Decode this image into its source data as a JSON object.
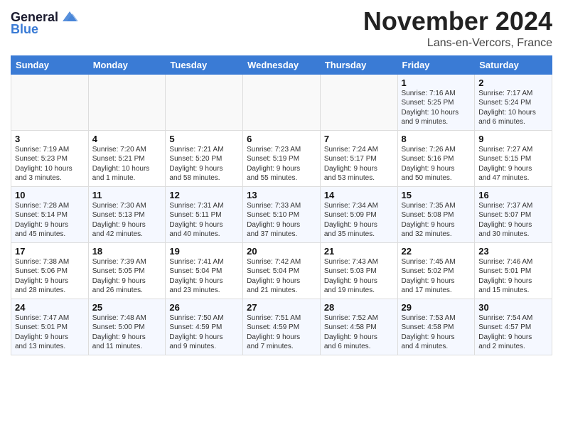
{
  "header": {
    "logo_line1": "General",
    "logo_line2": "Blue",
    "month_title": "November 2024",
    "location": "Lans-en-Vercors, France"
  },
  "weekdays": [
    "Sunday",
    "Monday",
    "Tuesday",
    "Wednesday",
    "Thursday",
    "Friday",
    "Saturday"
  ],
  "weeks": [
    [
      {
        "day": "",
        "text": ""
      },
      {
        "day": "",
        "text": ""
      },
      {
        "day": "",
        "text": ""
      },
      {
        "day": "",
        "text": ""
      },
      {
        "day": "",
        "text": ""
      },
      {
        "day": "1",
        "text": "Sunrise: 7:16 AM\nSunset: 5:25 PM\nDaylight: 10 hours\nand 9 minutes."
      },
      {
        "day": "2",
        "text": "Sunrise: 7:17 AM\nSunset: 5:24 PM\nDaylight: 10 hours\nand 6 minutes."
      }
    ],
    [
      {
        "day": "3",
        "text": "Sunrise: 7:19 AM\nSunset: 5:23 PM\nDaylight: 10 hours\nand 3 minutes."
      },
      {
        "day": "4",
        "text": "Sunrise: 7:20 AM\nSunset: 5:21 PM\nDaylight: 10 hours\nand 1 minute."
      },
      {
        "day": "5",
        "text": "Sunrise: 7:21 AM\nSunset: 5:20 PM\nDaylight: 9 hours\nand 58 minutes."
      },
      {
        "day": "6",
        "text": "Sunrise: 7:23 AM\nSunset: 5:19 PM\nDaylight: 9 hours\nand 55 minutes."
      },
      {
        "day": "7",
        "text": "Sunrise: 7:24 AM\nSunset: 5:17 PM\nDaylight: 9 hours\nand 53 minutes."
      },
      {
        "day": "8",
        "text": "Sunrise: 7:26 AM\nSunset: 5:16 PM\nDaylight: 9 hours\nand 50 minutes."
      },
      {
        "day": "9",
        "text": "Sunrise: 7:27 AM\nSunset: 5:15 PM\nDaylight: 9 hours\nand 47 minutes."
      }
    ],
    [
      {
        "day": "10",
        "text": "Sunrise: 7:28 AM\nSunset: 5:14 PM\nDaylight: 9 hours\nand 45 minutes."
      },
      {
        "day": "11",
        "text": "Sunrise: 7:30 AM\nSunset: 5:13 PM\nDaylight: 9 hours\nand 42 minutes."
      },
      {
        "day": "12",
        "text": "Sunrise: 7:31 AM\nSunset: 5:11 PM\nDaylight: 9 hours\nand 40 minutes."
      },
      {
        "day": "13",
        "text": "Sunrise: 7:33 AM\nSunset: 5:10 PM\nDaylight: 9 hours\nand 37 minutes."
      },
      {
        "day": "14",
        "text": "Sunrise: 7:34 AM\nSunset: 5:09 PM\nDaylight: 9 hours\nand 35 minutes."
      },
      {
        "day": "15",
        "text": "Sunrise: 7:35 AM\nSunset: 5:08 PM\nDaylight: 9 hours\nand 32 minutes."
      },
      {
        "day": "16",
        "text": "Sunrise: 7:37 AM\nSunset: 5:07 PM\nDaylight: 9 hours\nand 30 minutes."
      }
    ],
    [
      {
        "day": "17",
        "text": "Sunrise: 7:38 AM\nSunset: 5:06 PM\nDaylight: 9 hours\nand 28 minutes."
      },
      {
        "day": "18",
        "text": "Sunrise: 7:39 AM\nSunset: 5:05 PM\nDaylight: 9 hours\nand 26 minutes."
      },
      {
        "day": "19",
        "text": "Sunrise: 7:41 AM\nSunset: 5:04 PM\nDaylight: 9 hours\nand 23 minutes."
      },
      {
        "day": "20",
        "text": "Sunrise: 7:42 AM\nSunset: 5:04 PM\nDaylight: 9 hours\nand 21 minutes."
      },
      {
        "day": "21",
        "text": "Sunrise: 7:43 AM\nSunset: 5:03 PM\nDaylight: 9 hours\nand 19 minutes."
      },
      {
        "day": "22",
        "text": "Sunrise: 7:45 AM\nSunset: 5:02 PM\nDaylight: 9 hours\nand 17 minutes."
      },
      {
        "day": "23",
        "text": "Sunrise: 7:46 AM\nSunset: 5:01 PM\nDaylight: 9 hours\nand 15 minutes."
      }
    ],
    [
      {
        "day": "24",
        "text": "Sunrise: 7:47 AM\nSunset: 5:01 PM\nDaylight: 9 hours\nand 13 minutes."
      },
      {
        "day": "25",
        "text": "Sunrise: 7:48 AM\nSunset: 5:00 PM\nDaylight: 9 hours\nand 11 minutes."
      },
      {
        "day": "26",
        "text": "Sunrise: 7:50 AM\nSunset: 4:59 PM\nDaylight: 9 hours\nand 9 minutes."
      },
      {
        "day": "27",
        "text": "Sunrise: 7:51 AM\nSunset: 4:59 PM\nDaylight: 9 hours\nand 7 minutes."
      },
      {
        "day": "28",
        "text": "Sunrise: 7:52 AM\nSunset: 4:58 PM\nDaylight: 9 hours\nand 6 minutes."
      },
      {
        "day": "29",
        "text": "Sunrise: 7:53 AM\nSunset: 4:58 PM\nDaylight: 9 hours\nand 4 minutes."
      },
      {
        "day": "30",
        "text": "Sunrise: 7:54 AM\nSunset: 4:57 PM\nDaylight: 9 hours\nand 2 minutes."
      }
    ]
  ]
}
